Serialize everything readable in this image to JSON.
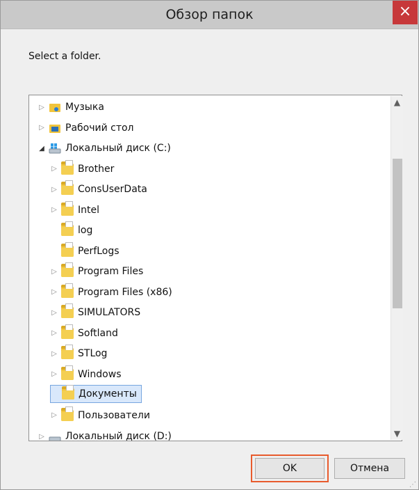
{
  "window": {
    "title": "Обзор папок",
    "close_glyph": "×"
  },
  "prompt": "Select a folder.",
  "tree": [
    {
      "label": "Музыка",
      "icon": "music-folder-icon",
      "expand": "collapsed"
    },
    {
      "label": "Рабочий стол",
      "icon": "desktop-folder-icon",
      "expand": "collapsed"
    },
    {
      "label": "Локальный диск (C:)",
      "icon": "system-drive-icon",
      "expand": "expanded"
    },
    {
      "label": "Brother",
      "icon": "folder-icon",
      "expand": "collapsed"
    },
    {
      "label": "ConsUserData",
      "icon": "folder-icon",
      "expand": "collapsed"
    },
    {
      "label": "Intel",
      "icon": "folder-icon",
      "expand": "collapsed"
    },
    {
      "label": "log",
      "icon": "folder-icon",
      "expand": "none"
    },
    {
      "label": "PerfLogs",
      "icon": "folder-icon",
      "expand": "none"
    },
    {
      "label": "Program Files",
      "icon": "folder-icon",
      "expand": "collapsed"
    },
    {
      "label": "Program Files (x86)",
      "icon": "folder-icon",
      "expand": "collapsed"
    },
    {
      "label": "SIMULATORS",
      "icon": "folder-icon",
      "expand": "collapsed"
    },
    {
      "label": "Softland",
      "icon": "folder-icon",
      "expand": "collapsed"
    },
    {
      "label": "STLog",
      "icon": "folder-icon",
      "expand": "collapsed"
    },
    {
      "label": "Windows",
      "icon": "folder-icon",
      "expand": "collapsed"
    },
    {
      "label": "Документы",
      "icon": "folder-icon",
      "expand": "none",
      "selected": true
    },
    {
      "label": "Пользователи",
      "icon": "folder-icon",
      "expand": "collapsed"
    },
    {
      "label": "Локальный диск (D:)",
      "icon": "drive-icon",
      "expand": "collapsed"
    }
  ],
  "buttons": {
    "ok": "OK",
    "cancel": "Отмена"
  },
  "colors": {
    "highlight": "#e85b2d",
    "selection": "#d9e8fb",
    "close": "#c7383a"
  }
}
